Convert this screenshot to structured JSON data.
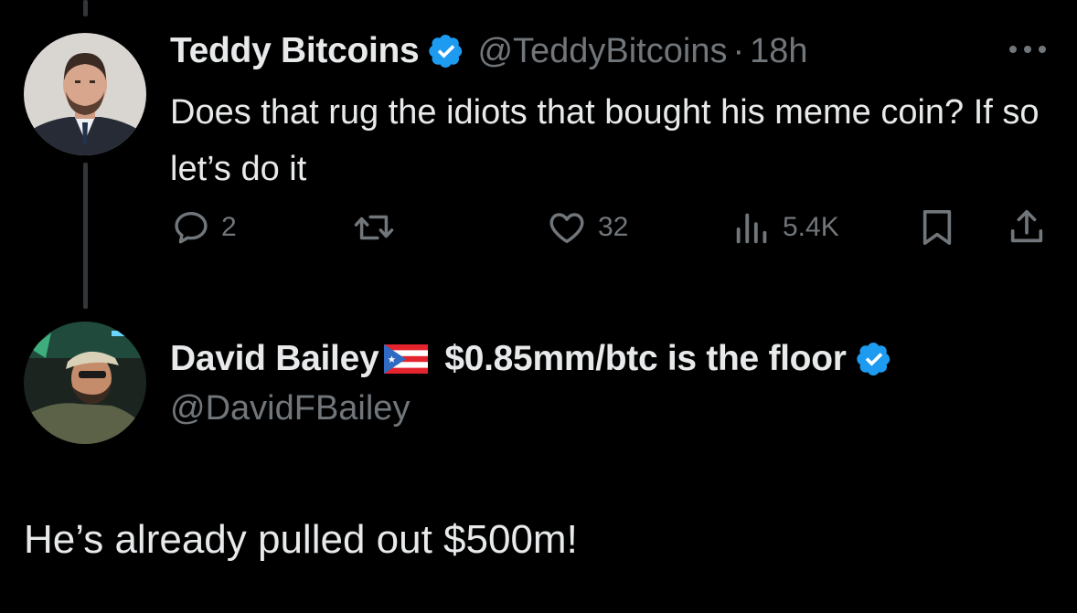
{
  "tweet": {
    "author_name": "Teddy Bitcoins",
    "handle": "@TeddyBitcoins",
    "separator": "·",
    "time": "18h",
    "text": "Does that rug the idiots that bought his meme coin? If so let’s do it",
    "verified": true,
    "more_icon": "more-horizontal-icon",
    "stats": {
      "replies": "2",
      "retweets": "",
      "likes": "32",
      "views": "5.4K"
    }
  },
  "reply_author": {
    "name": "David Bailey",
    "flag_icon": "puerto-rico-flag-icon",
    "name_suffix": "$0.85mm/btc is the floor",
    "handle": "@DavidFBailey",
    "verified": true
  },
  "reply": {
    "text": "He’s already pulled out $500m!"
  },
  "colors": {
    "background": "#000000",
    "text_primary": "#e7e9ea",
    "text_secondary": "#71767b",
    "verified_blue": "#1d9bf0",
    "thread_line": "#333639"
  }
}
